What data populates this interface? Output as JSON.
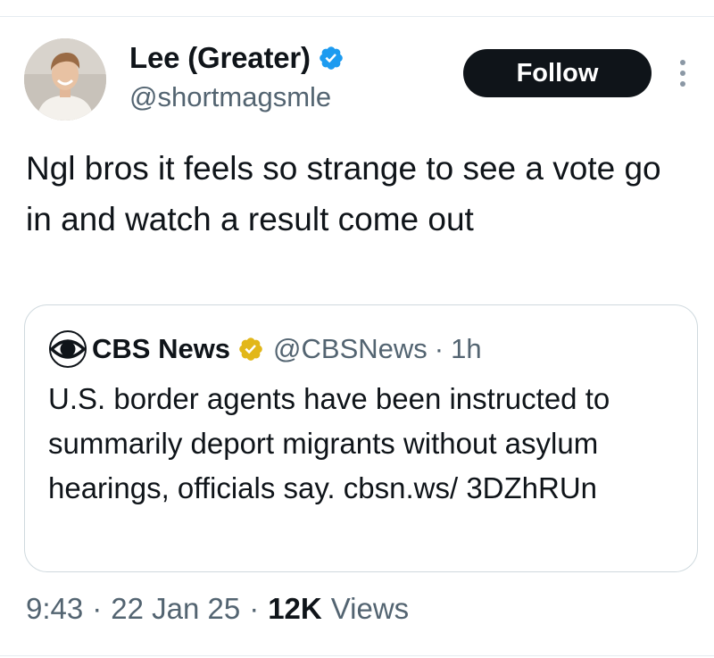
{
  "author": {
    "display_name": "Lee (Greater)",
    "handle": "@shortmagsmle",
    "verified": true,
    "verified_color": "#1d9bf0"
  },
  "follow_label": "Follow",
  "tweet": {
    "text": "Ngl bros it feels so strange to see a vote go in and watch a result come out"
  },
  "quote": {
    "name": "CBS News",
    "handle": "@CBSNews",
    "separator": "·",
    "time": "1h",
    "verified_color": "#e2b719",
    "text": "U.S. border agents have been instructed to summarily deport migrants without asylum hearings, officials say. cbsn.ws/ 3DZhRUn"
  },
  "meta": {
    "time": "9:43",
    "separator": "·",
    "date": "22 Jan 25",
    "views_count": "12K",
    "views_label": "Views"
  },
  "colors": {
    "text_primary": "#0f1419",
    "text_secondary": "#536471",
    "border": "#cfd9de",
    "follow_bg": "#0f1419"
  },
  "icons": [
    "avatar-photo",
    "verified-badge-icon",
    "more-options-icon",
    "cbs-eye-logo-icon",
    "gold-verified-badge-icon"
  ]
}
